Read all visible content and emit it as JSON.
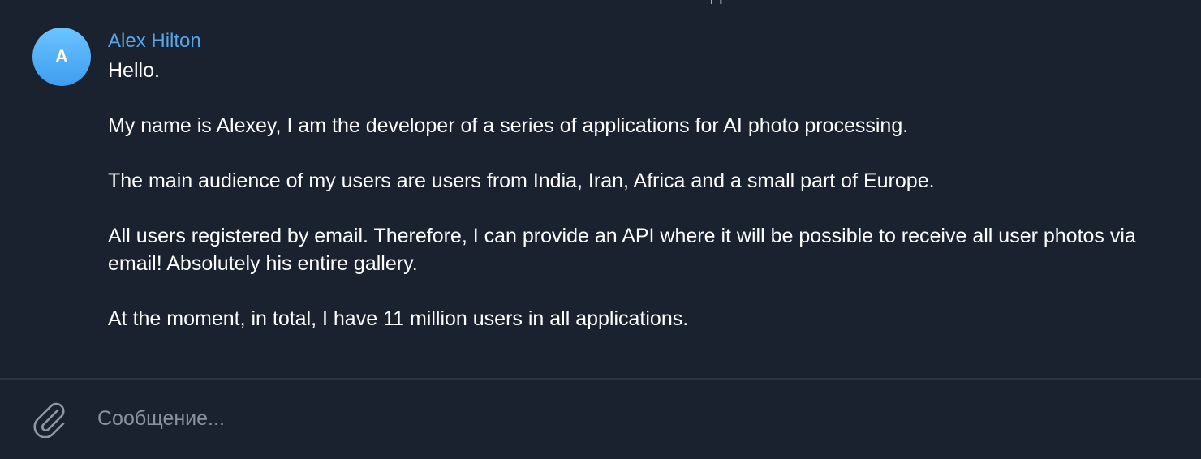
{
  "chat": {
    "date_separator": "Сегодня"
  },
  "message": {
    "avatar_letter": "A",
    "sender": "Alex Hilton",
    "paragraphs": [
      "Hello.",
      "My name is Alexey, I am the developer of a series of applications for AI photo processing.",
      "The main audience of my users are users from India, Iran, Africa and a small part of Europe.",
      "All users registered by email. Therefore, I can provide an API where it will be possible to receive all user photos via email! Absolutely his entire gallery.",
      "At the moment, in total, I have 11 million users in all applications."
    ]
  },
  "composer": {
    "placeholder": "Сообщение...",
    "value": "",
    "attach_icon": "paperclip-icon"
  },
  "colors": {
    "background": "#1a2230",
    "sender_name": "#58a6e8",
    "avatar_gradient_top": "#6cc4ff",
    "avatar_gradient_bottom": "#3d9df0",
    "placeholder": "#8a929d",
    "divider": "#2b3442"
  }
}
